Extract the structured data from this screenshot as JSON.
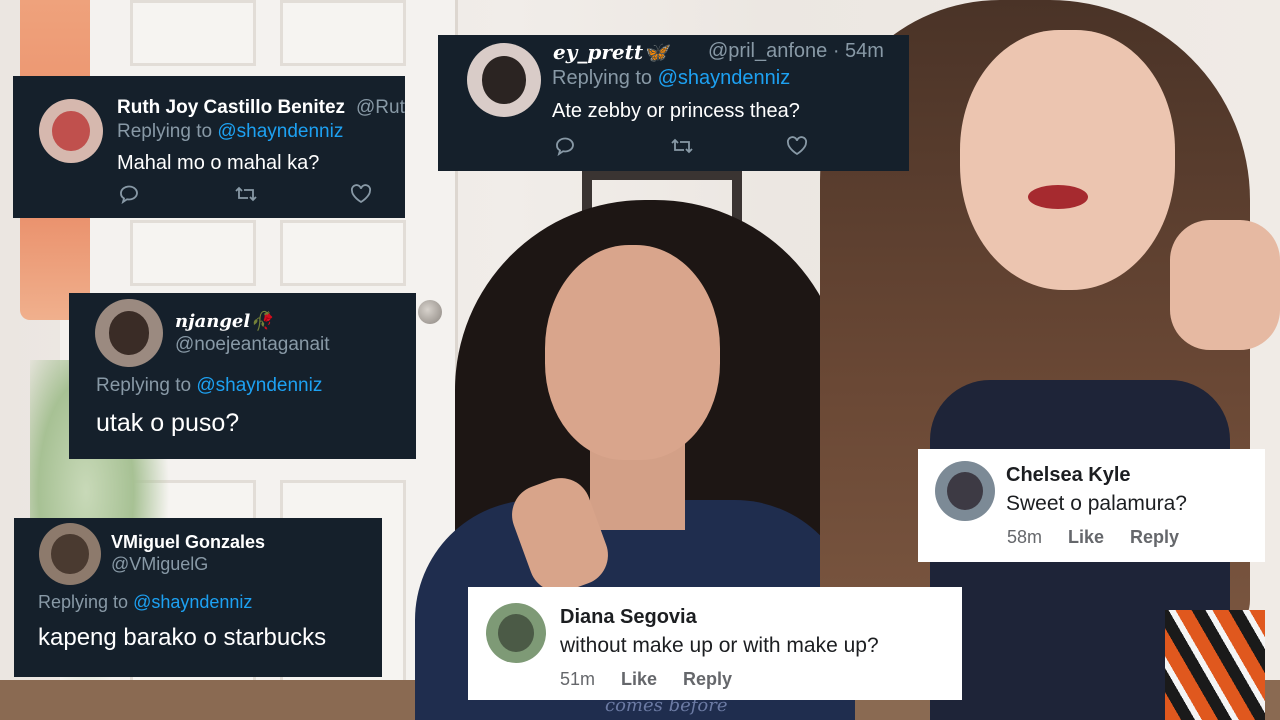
{
  "twitter_replies": [
    {
      "display_name": "Ruth Joy Castillo Benitez",
      "handle": "@Rut",
      "replying_prefix": "Replying to ",
      "replying_to": "@shayndenniz",
      "text": "Mahal mo o mahal ka?"
    },
    {
      "display_name": "ey_prett🦋",
      "handle": "@pril_anfone · 54m",
      "replying_prefix": "Replying to ",
      "replying_to": "@shayndenniz",
      "text": "Ate zebby or princess thea?"
    },
    {
      "display_name": "njangel🥀",
      "handle": "@noejeantaganait",
      "replying_prefix": "Replying to ",
      "replying_to": "@shayndenniz",
      "text": "utak o puso?"
    },
    {
      "display_name": "VMiguel Gonzales",
      "handle": "@VMiguelG",
      "replying_prefix": "Replying to ",
      "replying_to": "@shayndenniz",
      "text": "kapeng barako o starbucks"
    }
  ],
  "facebook_comments": [
    {
      "name": "Chelsea Kyle",
      "text": "Sweet o palamura?",
      "time": "58m",
      "like_label": "Like",
      "reply_label": "Reply"
    },
    {
      "name": "Diana Segovia",
      "text": "without make up or with make up?",
      "time": "51m",
      "like_label": "Like",
      "reply_label": "Reply"
    }
  ],
  "icons": {
    "reply": "speech-bubble-icon",
    "retweet": "retweet-icon",
    "like": "heart-icon"
  },
  "shirt_text": "comes before"
}
